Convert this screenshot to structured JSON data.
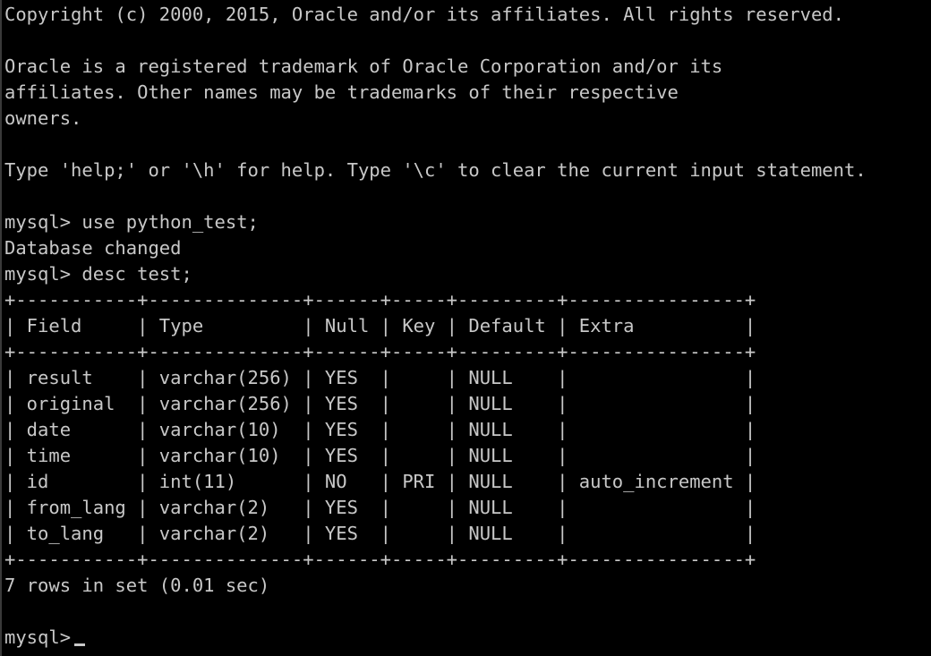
{
  "console": {
    "copyright": "Copyright (c) 2000, 2015, Oracle and/or its affiliates. All rights reserved.",
    "trademark_lines": [
      "Oracle is a registered trademark of Oracle Corporation and/or its",
      "affiliates. Other names may be trademarks of their respective",
      "owners."
    ],
    "help_line": "Type 'help;' or '\\h' for help. Type '\\c' to clear the current input statement.",
    "prompt": "mysql>",
    "cmd_use": "use python_test;",
    "db_changed": "Database changed",
    "cmd_desc": "desc test;",
    "table_border": "+-----------+--------------+------+-----+---------+----------------+",
    "table_header": "| Field     | Type         | Null | Key | Default | Extra          |",
    "table_rows": [
      "| result    | varchar(256) | YES  |     | NULL    |                |",
      "| original  | varchar(256) | YES  |     | NULL    |                |",
      "| date      | varchar(10)  | YES  |     | NULL    |                |",
      "| time      | varchar(10)  | YES  |     | NULL    |                |",
      "| id        | int(11)      | NO   | PRI | NULL    | auto_increment |",
      "| from_lang | varchar(2)   | YES  |     | NULL    |                |",
      "| to_lang   | varchar(2)   | YES  |     | NULL    |                |"
    ],
    "result_summary": "7 rows in set (0.01 sec)"
  },
  "colors": {
    "background": "#000000",
    "text": "#c8c8c8"
  }
}
